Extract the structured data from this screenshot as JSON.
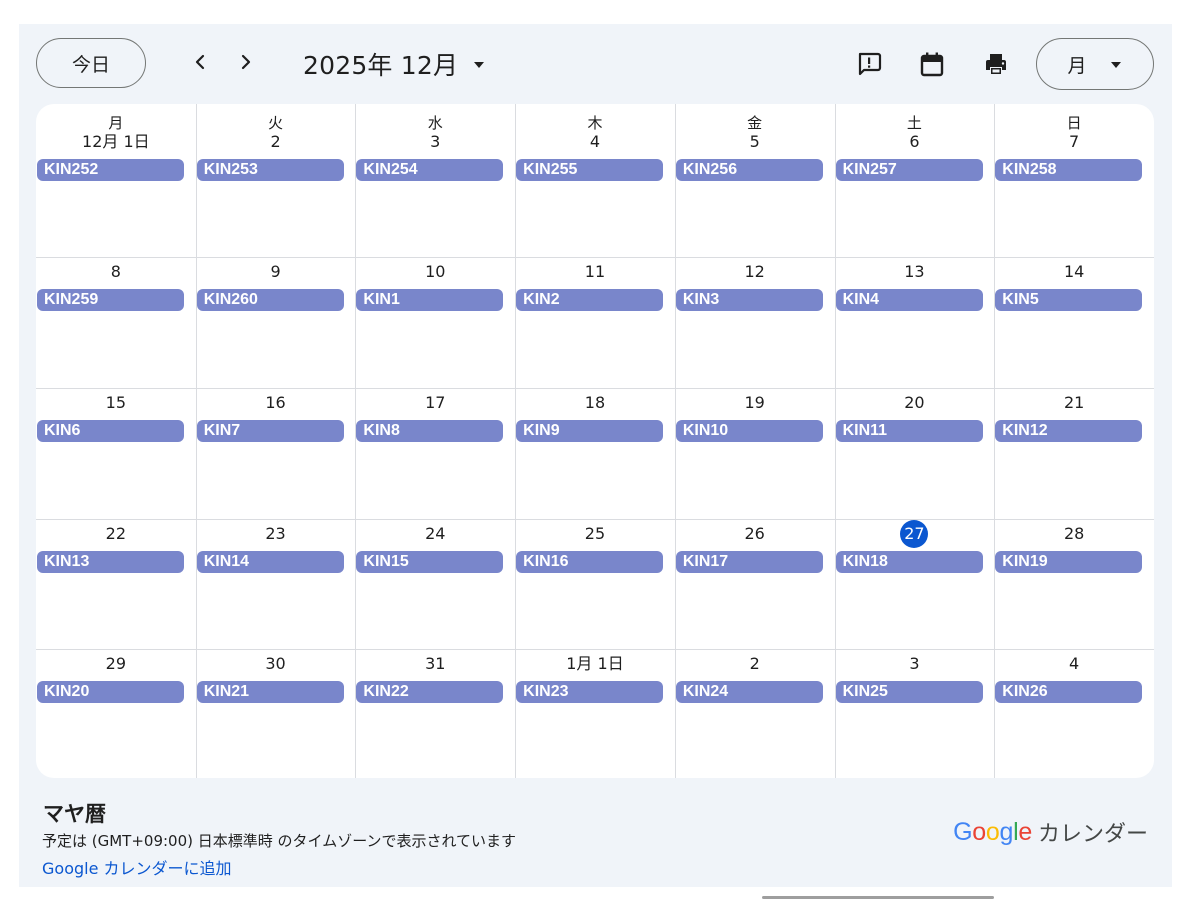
{
  "toolbar": {
    "today_label": "今日",
    "period_label": "2025年 12月",
    "view_label": "月"
  },
  "icons": {
    "prev": "chevron-left-icon",
    "next": "chevron-right-icon",
    "period_dropdown": "caret-down-icon",
    "feedback": "feedback-icon",
    "calendar": "calendar-icon",
    "print": "print-icon",
    "view_dropdown": "caret-down-icon"
  },
  "colors": {
    "event_bg": "#7986cb",
    "today_circle": "#0b57d0",
    "link": "#0b57d0",
    "page_bg": "#f0f4f9"
  },
  "weekdays": [
    "月",
    "火",
    "水",
    "木",
    "金",
    "土",
    "日"
  ],
  "weeks": [
    [
      {
        "date": "12月 1日",
        "event": "KIN252"
      },
      {
        "date": "2",
        "event": "KIN253"
      },
      {
        "date": "3",
        "event": "KIN254"
      },
      {
        "date": "4",
        "event": "KIN255"
      },
      {
        "date": "5",
        "event": "KIN256"
      },
      {
        "date": "6",
        "event": "KIN257"
      },
      {
        "date": "7",
        "event": "KIN258"
      }
    ],
    [
      {
        "date": "8",
        "event": "KIN259"
      },
      {
        "date": "9",
        "event": "KIN260"
      },
      {
        "date": "10",
        "event": "KIN1"
      },
      {
        "date": "11",
        "event": "KIN2"
      },
      {
        "date": "12",
        "event": "KIN3"
      },
      {
        "date": "13",
        "event": "KIN4"
      },
      {
        "date": "14",
        "event": "KIN5"
      }
    ],
    [
      {
        "date": "15",
        "event": "KIN6"
      },
      {
        "date": "16",
        "event": "KIN7"
      },
      {
        "date": "17",
        "event": "KIN8"
      },
      {
        "date": "18",
        "event": "KIN9"
      },
      {
        "date": "19",
        "event": "KIN10"
      },
      {
        "date": "20",
        "event": "KIN11"
      },
      {
        "date": "21",
        "event": "KIN12"
      }
    ],
    [
      {
        "date": "22",
        "event": "KIN13"
      },
      {
        "date": "23",
        "event": "KIN14"
      },
      {
        "date": "24",
        "event": "KIN15"
      },
      {
        "date": "25",
        "event": "KIN16"
      },
      {
        "date": "26",
        "event": "KIN17"
      },
      {
        "date": "27",
        "event": "KIN18",
        "today": true
      },
      {
        "date": "28",
        "event": "KIN19"
      }
    ],
    [
      {
        "date": "29",
        "event": "KIN20"
      },
      {
        "date": "30",
        "event": "KIN21"
      },
      {
        "date": "31",
        "event": "KIN22"
      },
      {
        "date": "1月 1日",
        "event": "KIN23"
      },
      {
        "date": "2",
        "event": "KIN24"
      },
      {
        "date": "3",
        "event": "KIN25"
      },
      {
        "date": "4",
        "event": "KIN26"
      }
    ]
  ],
  "footer": {
    "calendar_name": "マヤ暦",
    "timezone_note": "予定は (GMT+09:00) 日本標準時 のタイムゾーンで表示されています",
    "add_link": "Google カレンダーに追加",
    "brand_logo_letters": [
      "G",
      "o",
      "o",
      "g",
      "l",
      "e"
    ],
    "brand_logo_colors": [
      "#4285f4",
      "#ea4335",
      "#fbbc05",
      "#4285f4",
      "#34a853",
      "#ea4335"
    ],
    "brand_name": "カレンダー"
  }
}
